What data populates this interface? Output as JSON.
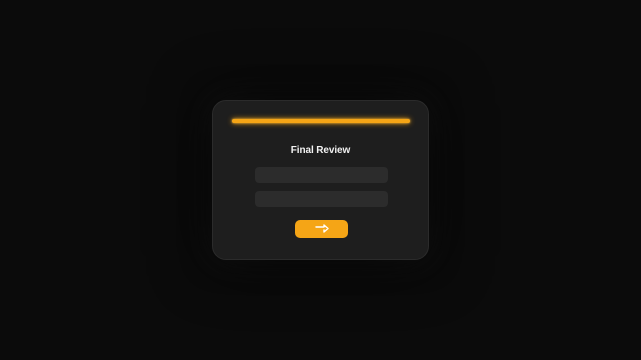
{
  "form": {
    "title": "Final Review",
    "progress_fraction": 1.0,
    "fields": [
      {
        "value": "",
        "placeholder": ""
      },
      {
        "value": "",
        "placeholder": ""
      }
    ],
    "submit_icon": "send-arrow-icon"
  },
  "colors": {
    "page_background": "#0b0b0b",
    "card_background": "#1e1e1e",
    "accent": "#f5a516",
    "field_background": "#2c2c2c",
    "title_text": "#f2f2f2"
  }
}
